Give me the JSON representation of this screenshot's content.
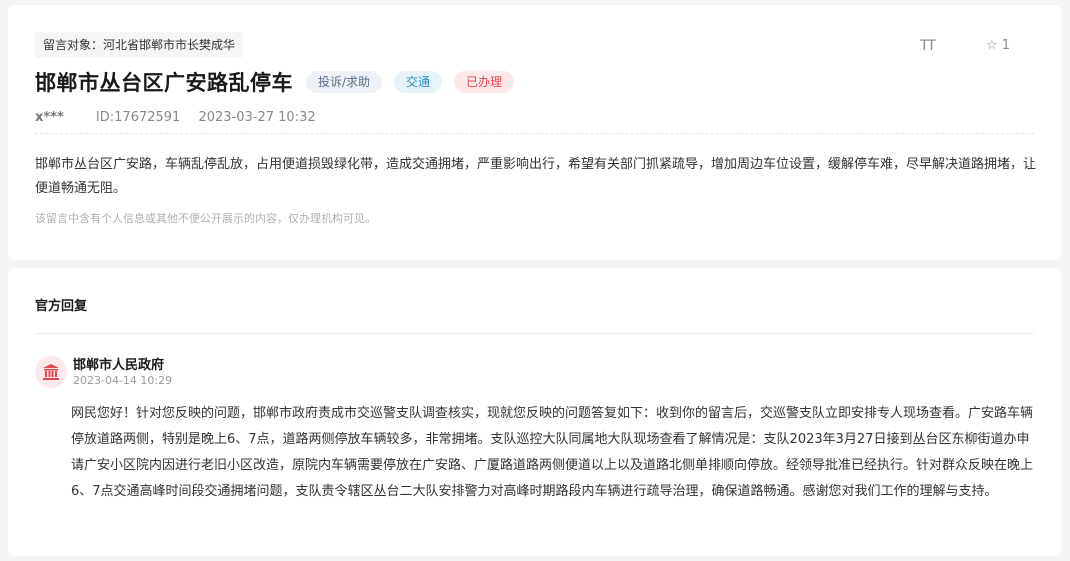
{
  "message": {
    "target": "留言对象：河北省邯郸市市长樊成华",
    "font_toggle": "TT",
    "star_count": "1",
    "title": "邯郸市丛台区广安路乱停车",
    "tags": {
      "type": "投诉/求助",
      "category": "交通",
      "status": "已办理"
    },
    "user": "x***",
    "id": "ID:17672591",
    "datetime": "2023-03-27 10:32",
    "content": "邯郸市丛台区广安路，车辆乱停乱放，占用便道损毁绿化带，造成交通拥堵，严重影响出行，希望有关部门抓紧疏导，增加周边车位设置，缓解停车难，尽早解决道路拥堵，让便道畅通无阻。",
    "privacy_note": "该留言中含有个人信息或其他不便公开展示的内容，仅办理机构可见。"
  },
  "reply": {
    "heading": "官方回复",
    "org": "邯郸市人民政府",
    "date": "2023-04-14 10:29",
    "text": "网民您好！针对您反映的问题，邯郸市政府责成市交巡警支队调查核实，现就您反映的问题答复如下：收到你的留言后，交巡警支队立即安排专人现场查看。广安路车辆停放道路两侧，特别是晚上6、7点，道路两侧停放车辆较多，非常拥堵。支队巡控大队同属地大队现场查看了解情况是：支队2023年3月27日接到丛台区东柳街道办申请广安小区院内因进行老旧小区改造，原院内车辆需要停放在广安路、广厦路道路两侧便道以上以及道路北侧单排顺向停放。经领导批准已经执行。针对群众反映在晚上6、7点交通高峰时间段交通拥堵问题，支队责令辖区丛台二大队安排警力对高峰时期路段内车辆进行疏导治理，确保道路畅通。感谢您对我们工作的理解与支持。"
  },
  "colors": {
    "status_red": "#e0474f",
    "category_blue": "#2a8cbf",
    "avatar_bg": "#fde8ea"
  },
  "icons": {
    "font": "font-size-icon",
    "star": "star-icon",
    "avatar": "government-building-icon"
  }
}
